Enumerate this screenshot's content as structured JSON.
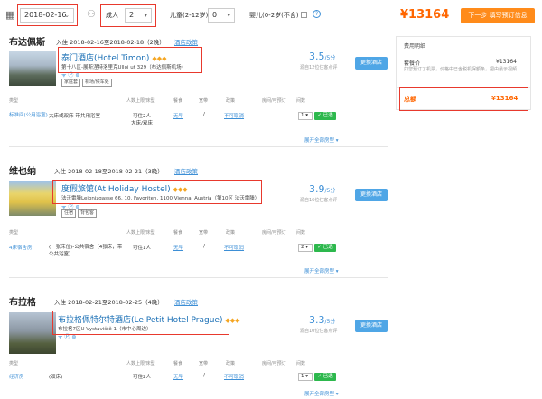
{
  "search": {
    "date": "2018-02-16",
    "adults_label": "成人",
    "adults_value": "2",
    "children_label": "儿童(2-12岁)",
    "children_value": "0",
    "infant_label": "婴儿(0-2岁(不含)"
  },
  "total": {
    "price": "¥13164",
    "next_button": "下一步 填写预订信息"
  },
  "sidebar": {
    "title": "费用明细",
    "line1_label": "套餐价",
    "line1_value": "¥13164",
    "note": "如您预订了机票，价格中已含税机保额条，把由最示视频",
    "total_label": "总额",
    "total_value": "¥13164"
  },
  "table_headers": {
    "type": "类型",
    "capacity": "人数上限/床型",
    "meal": "餐食",
    "broadband": "宽带",
    "policy": "政策",
    "reserve": "房间/可预订",
    "rooms": "间数"
  },
  "common": {
    "policy_link": "酒店政策",
    "change_hotel": "更换酒店",
    "expand_all": "展开全部房型 ▾",
    "selected": "✓ 已选",
    "cancel_policy": "不可取消"
  },
  "cities": [
    {
      "name": "布达佩斯",
      "stay": "入住  2018-02-16至2018-02-18（2晚）",
      "hotel_name": "泰门酒店(Hotel Timon)",
      "stars": "◆◆◆",
      "address": "第十八区-展斯涅特洛里克Ulloi ut 329（布达佩斯机场）",
      "tags": [
        "家庭套",
        "机场/候车处"
      ],
      "score": "3.5",
      "score_suffix": "/5分",
      "reviews": "源自12位住客点评",
      "room_type": "标准间(公用浴室)",
      "room_desc": "大床或双床-带共用浴室",
      "capacity": "可住2人",
      "bed": "大床/双床",
      "meal": "无早",
      "broadband": "/",
      "qty": "1"
    },
    {
      "name": "维也纳",
      "stay": "入住  2018-02-18至2018-02-21（3晚）",
      "hotel_name": "度假旅馆(At Holiday Hostel)",
      "stars": "◆◆◆",
      "address": "法沃雷滕Leibnizgasse 66, 10. Favoriten, 1100 Vienna, Austria（第10区 法沃雷滕）",
      "tags": [
        "住宿",
        "背包客"
      ],
      "score": "3.9",
      "score_suffix": "/5分",
      "reviews": "源自16位住客点评",
      "room_type": "4床宿舍房",
      "room_desc": "(一张床位)-公共宿舍（4张床，带公共浴室）",
      "capacity": "可住1人",
      "bed": "",
      "meal": "无早",
      "broadband": "/",
      "qty": "2"
    },
    {
      "name": "布拉格",
      "stay": "入住  2018-02-21至2018-02-25（4晚）",
      "hotel_name": "布拉格佩特尔特酒店(Le Petit Hotel Prague)",
      "stars": "◆◆◆",
      "address": "布拉格7区U Vystaviště 1（市中心周边）",
      "tags": [],
      "score": "3.3",
      "score_suffix": "/5分",
      "reviews": "源自10位住客点评",
      "room_type": "经济房",
      "room_desc": "(双床)",
      "capacity": "可住2人",
      "bed": "",
      "meal": "无早",
      "broadband": "/",
      "qty": "1"
    }
  ],
  "colors": {
    "accent_orange": "#ff6600",
    "link_blue": "#3d8fd6",
    "select_green": "#2db84d",
    "highlight_red": "#e8392d"
  }
}
